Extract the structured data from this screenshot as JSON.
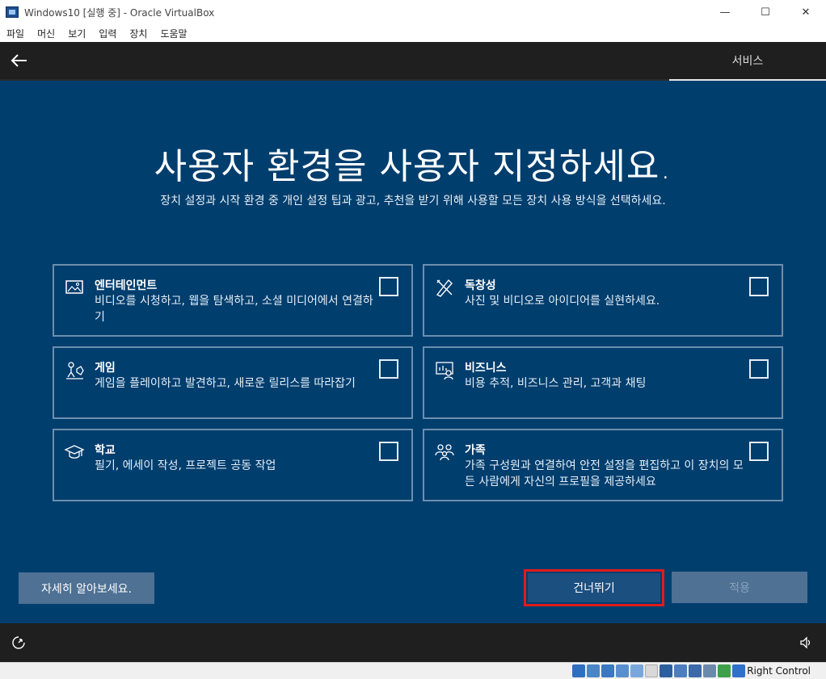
{
  "window": {
    "title": "Windows10 [실행 중] - Oracle VirtualBox",
    "controls": {
      "minimize": "—",
      "maximize": "☐",
      "close": "✕"
    }
  },
  "menubar": {
    "items": [
      "파일",
      "머신",
      "보기",
      "입력",
      "장치",
      "도움말"
    ]
  },
  "guest": {
    "topbar": {
      "tab_label": "서비스"
    },
    "heading": "사용자 환경을 사용자 지정하세요.",
    "subheading": "장치 설정과 시작 환경 중 개인 설정 팁과 광고, 추천을 받기 위해 사용할 모든 장치 사용 방식을 선택하세요.",
    "cards": [
      {
        "title": "엔터테인먼트",
        "desc": "비디오를 시청하고, 웹을 탐색하고, 소셜 미디어에서 연결하기",
        "icon": "picture-icon",
        "checked": false
      },
      {
        "title": "독창성",
        "desc": "사진 및 비디오로 아이디어를 실현하세요.",
        "icon": "pen-ruler-icon",
        "checked": false
      },
      {
        "title": "게임",
        "desc": "게임을 플레이하고 발견하고, 새로운 릴리스를 따라잡기",
        "icon": "gaming-icon",
        "checked": false
      },
      {
        "title": "비즈니스",
        "desc": "비용 추적, 비즈니스 관리, 고객과 채팅",
        "icon": "business-icon",
        "checked": false
      },
      {
        "title": "학교",
        "desc": "필기, 에세이 작성, 프로젝트 공동 작업",
        "icon": "graduation-cap-icon",
        "checked": false
      },
      {
        "title": "가족",
        "desc": "가족 구성원과 연결하여 안전 설정을 편집하고 이 장치의 모든 사람에게 자신의 프로필을 제공하세요",
        "icon": "family-icon",
        "checked": false
      }
    ],
    "buttons": {
      "learn_more": "자세히 알아보세요.",
      "skip": "건너뛰기",
      "apply": "적용"
    }
  },
  "statusbar": {
    "host_key": "Right Control"
  },
  "colors": {
    "guest_bg": "#003e6e",
    "highlight": "#e21b1b",
    "button_bg": "#4e7194"
  }
}
